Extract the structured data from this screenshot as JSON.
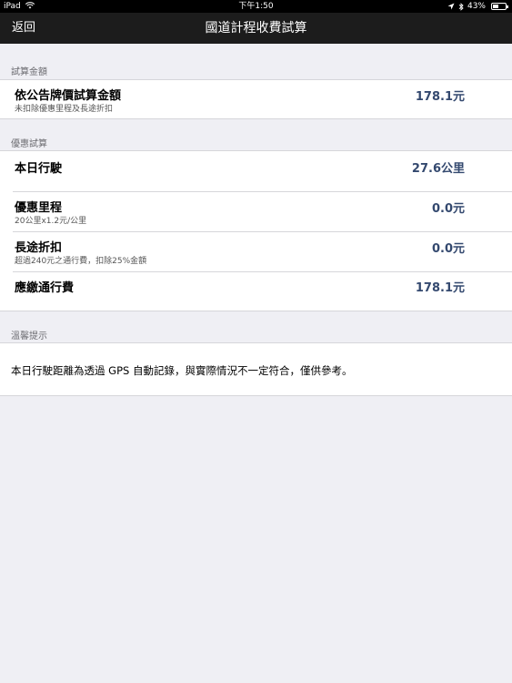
{
  "status_bar": {
    "device": "iPad",
    "time": "下午1:50",
    "battery_percent": 43,
    "battery_label": "43%",
    "icons": [
      "wifi-icon",
      "location-arrow-icon",
      "bluetooth-icon",
      "battery-icon"
    ]
  },
  "nav": {
    "back_label": "返回",
    "title": "國道計程收費試算"
  },
  "section_estimate": {
    "header": "試算金額",
    "rows": [
      {
        "label": "依公告牌價試算金額",
        "sub": "未扣除優惠里程及長途折扣",
        "value": "178.1元"
      }
    ]
  },
  "section_discount": {
    "header": "優惠試算",
    "rows": [
      {
        "label": "本日行駛",
        "sub": "",
        "value": "27.6公里"
      },
      {
        "label": "優惠里程",
        "sub": "20公里x1.2元/公里",
        "value": "0.0元"
      },
      {
        "label": "長途折扣",
        "sub": "超過240元之通行費，扣除25%金額",
        "value": "0.0元"
      },
      {
        "label": "應繳通行費",
        "sub": "",
        "value": "178.1元"
      }
    ]
  },
  "section_tips": {
    "header": "溫馨提示",
    "text": "本日行駛距離為透過 GPS 自動記錄，與實際情況不一定符合，僅供參考。"
  },
  "colors": {
    "background": "#efeff4",
    "nav_bar": "#1c1c1c",
    "value_text": "#34496f",
    "section_header": "#6d6d72"
  }
}
